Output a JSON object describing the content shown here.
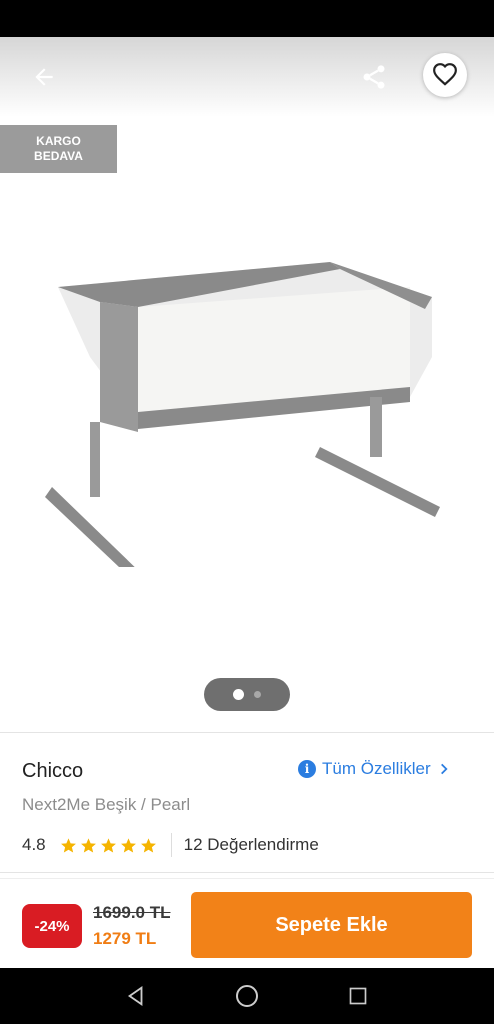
{
  "header": {
    "back_icon": "arrow-left-icon",
    "share_icon": "share-icon",
    "favorite_icon": "heart-outline-icon"
  },
  "badge": {
    "line1": "KARGO",
    "line2": "BEDAVA"
  },
  "gallery": {
    "image_count": 2,
    "active_index": 0
  },
  "product": {
    "brand": "Chicco",
    "name": "Next2Me Beşik / Pearl",
    "all_specs_label": "Tüm Özellikler",
    "rating": "4.8",
    "stars": 5,
    "reviews_label": "12 Değerlendirme"
  },
  "purchase": {
    "discount": "-24%",
    "old_price": "1699.0 TL",
    "new_price": "1279 TL",
    "cart_button_label": "Sepete Ekle"
  },
  "colors": {
    "accent_orange": "#f28218",
    "discount_red": "#d91c23",
    "link_blue": "#2b7de0",
    "star_yellow": "#f5b400"
  }
}
